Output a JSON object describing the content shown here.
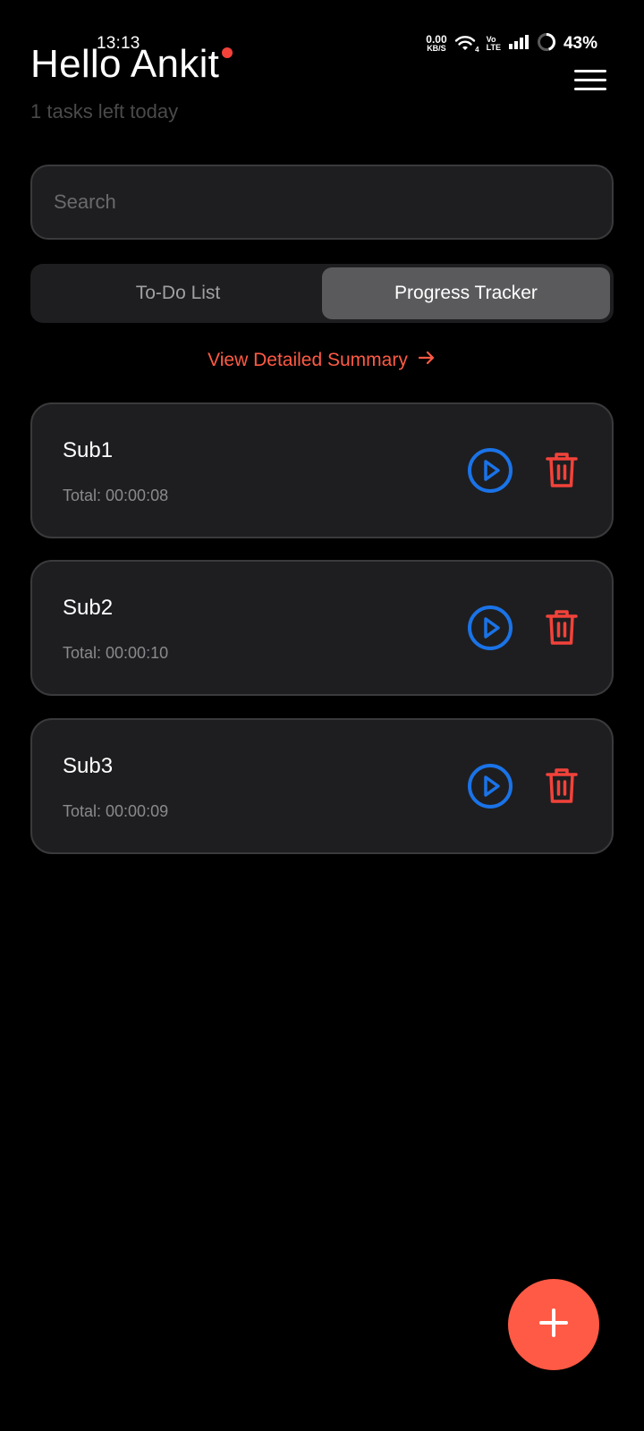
{
  "status_bar": {
    "time": "13:13",
    "net_speed_value": "0.00",
    "net_speed_unit": "KB/S",
    "wifi_badge": "4",
    "volte_top": "Vo",
    "volte_bottom": "LTE",
    "battery": "43%"
  },
  "header": {
    "greeting": "Hello Ankit",
    "subtitle": "1 tasks left today"
  },
  "search": {
    "placeholder": "Search",
    "value": ""
  },
  "tabs": [
    {
      "label": "To-Do List",
      "active": false
    },
    {
      "label": "Progress Tracker",
      "active": true
    }
  ],
  "summary_link": {
    "label": "View Detailed Summary"
  },
  "subjects": [
    {
      "name": "Sub1",
      "total": "Total: 00:00:08"
    },
    {
      "name": "Sub2",
      "total": "Total: 00:00:10"
    },
    {
      "name": "Sub3",
      "total": "Total: 00:00:09"
    }
  ],
  "icons": {
    "menu": "hamburger-menu-icon",
    "play": "play-circle-icon",
    "delete": "trash-icon",
    "add": "plus-icon",
    "arrow": "arrow-right-icon"
  },
  "colors": {
    "background": "#000000",
    "card": "#1e1e20",
    "accent": "#ff5a45",
    "play": "#1a73e8",
    "delete": "#f2423a",
    "notification_dot": "#f2423a"
  }
}
